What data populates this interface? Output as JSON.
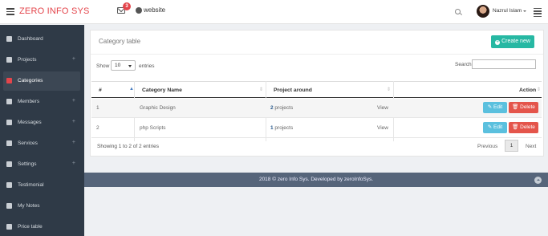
{
  "brand": "ZERO INFO SYS",
  "header": {
    "mail_count": "3",
    "website_label": "website",
    "user_name": "Nazrul Islam"
  },
  "sidebar": {
    "items": [
      {
        "label": "Dashboard",
        "icon": "dashboard-icon",
        "has_plus": false
      },
      {
        "label": "Projects",
        "icon": "cart-icon",
        "has_plus": true
      },
      {
        "label": "Categories",
        "icon": "tag-icon",
        "has_plus": false,
        "active": true
      },
      {
        "label": "Members",
        "icon": "users-icon",
        "has_plus": true
      },
      {
        "label": "Messages",
        "icon": "envelope-icon",
        "has_plus": true
      },
      {
        "label": "Services",
        "icon": "exchange-icon",
        "has_plus": true
      },
      {
        "label": "Settings",
        "icon": "cogs-icon",
        "has_plus": true
      },
      {
        "label": "Testimonial",
        "icon": "comments-icon",
        "has_plus": false
      },
      {
        "label": "My Notes",
        "icon": "file-icon",
        "has_plus": false
      },
      {
        "label": "Price table",
        "icon": "table-icon",
        "has_plus": false
      }
    ],
    "plus_symbol": "+"
  },
  "panel": {
    "title": "Category table",
    "create_label": "Create new",
    "show_label": "Show",
    "page_size": "10",
    "entries_label": "entries",
    "search_label": "Search:"
  },
  "table": {
    "headers": [
      "#",
      "Category Name",
      "Project around",
      "Action"
    ],
    "rows": [
      {
        "num": "1",
        "name": "Graphic Design",
        "count": "2",
        "count_suffix": " projects",
        "view": "View"
      },
      {
        "num": "2",
        "name": "php Scripts",
        "count": "1",
        "count_suffix": " projects",
        "view": "View"
      }
    ],
    "edit_label": "Edit",
    "delete_label": "Delete"
  },
  "pagination": {
    "info": "Showing 1 to 2 of 2 entries",
    "prev": "Previous",
    "current": "1",
    "next": "Next"
  },
  "footer": "2018 © zero Info Sys. Developed by zeroInfoSys.",
  "colors": {
    "brand": "#e4454b",
    "sidebar_bg": "#2f3a47",
    "create_button": "#27b8a3",
    "edit_button": "#5bc0de",
    "delete_button": "#e4554b",
    "footer_bg": "#56657a"
  }
}
